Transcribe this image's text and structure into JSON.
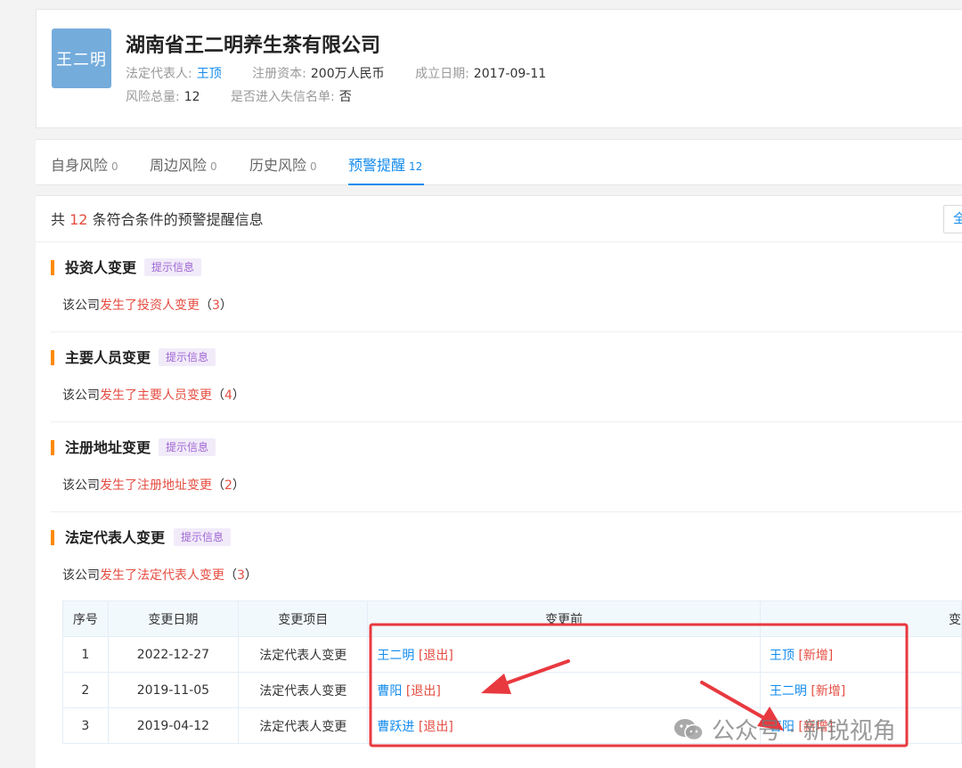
{
  "company": {
    "logo_text": "王二明",
    "name": "湖南省王二明养生茶有限公司",
    "legal_rep_label": "法定代表人:",
    "legal_rep": "王顶",
    "capital_label": "注册资本:",
    "capital": "200万人民币",
    "founded_label": "成立日期:",
    "founded": "2017-09-11",
    "risk_total_label": "风险总量:",
    "risk_total": "12",
    "dishonest_label": "是否进入失信名单:",
    "dishonest": "否"
  },
  "tabs": [
    {
      "label": "自身风险",
      "count": "0"
    },
    {
      "label": "周边风险",
      "count": "0"
    },
    {
      "label": "历史风险",
      "count": "0"
    },
    {
      "label": "预警提醒",
      "count": "12"
    }
  ],
  "summary": {
    "prefix": "共",
    "count": "12",
    "suffix": "条符合条件的预警提醒信息",
    "all_button": "全"
  },
  "sections": [
    {
      "title": "投资人变更",
      "tag": "提示信息",
      "desc_prefix": "该公司",
      "desc_link": "发生了投资人变更",
      "count_open": "（",
      "count": "3",
      "count_close": "）"
    },
    {
      "title": "主要人员变更",
      "tag": "提示信息",
      "desc_prefix": "该公司",
      "desc_link": "发生了主要人员变更",
      "count_open": "（",
      "count": "4",
      "count_close": "）"
    },
    {
      "title": "注册地址变更",
      "tag": "提示信息",
      "desc_prefix": "该公司",
      "desc_link": "发生了注册地址变更",
      "count_open": "（",
      "count": "2",
      "count_close": "）"
    },
    {
      "title": "法定代表人变更",
      "tag": "提示信息",
      "desc_prefix": "该公司",
      "desc_link": "发生了法定代表人变更",
      "count_open": "（",
      "count": "3",
      "count_close": "）"
    }
  ],
  "table": {
    "headers": [
      "序号",
      "变更日期",
      "变更项目",
      "变更前",
      "变"
    ],
    "rows": [
      {
        "no": "1",
        "date": "2022-12-27",
        "item": "法定代表人变更",
        "before_name": "王二明",
        "before_status": "[退出]",
        "after_name": "王顶",
        "after_status": "[新增]"
      },
      {
        "no": "2",
        "date": "2019-11-05",
        "item": "法定代表人变更",
        "before_name": "曹阳",
        "before_status": "[退出]",
        "after_name": "王二明",
        "after_status": "[新增]"
      },
      {
        "no": "3",
        "date": "2019-04-12",
        "item": "法定代表人变更",
        "before_name": "曹跃进",
        "before_status": "[退出]",
        "after_name": "曹阳",
        "after_status": "[新增]"
      }
    ]
  },
  "watermark": {
    "text": "公众号 · 新锐视角",
    "icon": "wechat-icon"
  },
  "annotation_color": "#e8393f"
}
